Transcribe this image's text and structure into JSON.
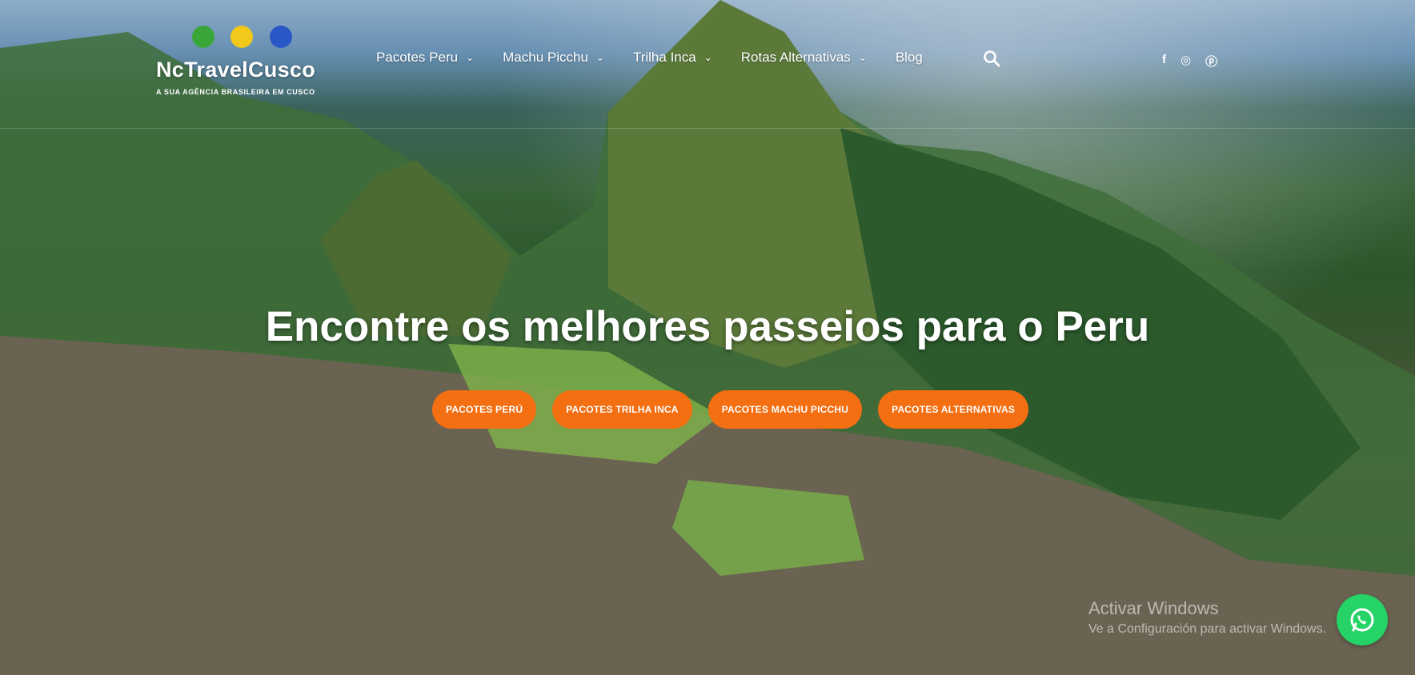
{
  "brand": {
    "name": "NcTravelCusco",
    "tagline": "A SUA AGÊNCIA BRASILEIRA EM CUSCO",
    "dot_colors": [
      "#3aa63a",
      "#f2c81b",
      "#2a57c6"
    ]
  },
  "nav": {
    "items": [
      {
        "label": "Pacotes Peru",
        "has_dropdown": true
      },
      {
        "label": "Machu Picchu",
        "has_dropdown": true
      },
      {
        "label": "Trilha Inca",
        "has_dropdown": true
      },
      {
        "label": "Rotas Alternativas",
        "has_dropdown": true
      },
      {
        "label": "Blog",
        "has_dropdown": false
      }
    ],
    "search_icon": "search-icon",
    "social": [
      {
        "label": "f",
        "icon": "facebook-icon"
      },
      {
        "label": "◎",
        "icon": "instagram-icon"
      },
      {
        "label": "ⓟ",
        "icon": "pinterest-icon"
      }
    ]
  },
  "hero": {
    "title": "Encontre os melhores passeios para o Peru",
    "buttons": [
      "PACOTES PERÚ",
      "PACOTES TRILHA INCA",
      "PACOTES MACHU PICCHU",
      "PACOTES ALTERNATIVAS"
    ],
    "button_color": "#f46e12"
  },
  "overlay": {
    "watermark_title": "Activar Windows",
    "watermark_sub": "Ve a Configuración para activar Windows."
  },
  "whatsapp_icon": "whatsapp-icon"
}
